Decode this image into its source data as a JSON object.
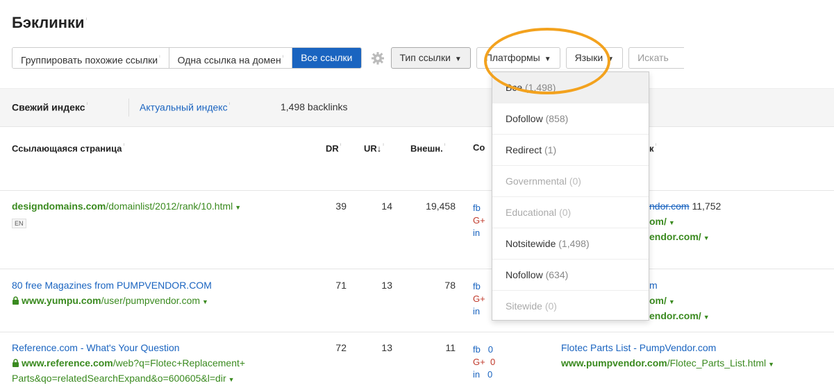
{
  "page": {
    "title": "Бэклинки"
  },
  "toolbar": {
    "group_similar": "Группировать похожие ссылки",
    "one_per_domain": "Одна ссылка на домен",
    "all_links": "Все ссылки",
    "link_type": "Тип ссылки",
    "platforms": "Платформы",
    "languages": "Языки",
    "search": "Искать"
  },
  "index": {
    "fresh": "Свежий индекс",
    "actual": "Актуальный индекс",
    "count": "1,498 backlinks"
  },
  "columns": {
    "referring_page": "Ссылающаяся страница",
    "dr": "DR",
    "ur": "UR↓",
    "external": "Внешн.",
    "social": "Со",
    "link": "к"
  },
  "rows": [
    {
      "title": "",
      "domain": "designdomains.com",
      "path": "/domainlist/2012/rank/10.html",
      "path2": "",
      "lang": "EN",
      "secure": false,
      "dr": "39",
      "ur": "14",
      "ext": "19,458",
      "fb": "fb",
      "fb_v": "",
      "gp": "G+",
      "gp_v": "",
      "in": "in",
      "in_v": "",
      "target_line1_strike": "ndor.com",
      "target_line1_num": "11,752",
      "target_line2": "om/",
      "target_line3": "endor.com/"
    },
    {
      "title": "80 free Magazines from PUMPVENDOR.COM",
      "domain": "www.yumpu.com",
      "path": "/user/pumpvendor.com",
      "path2": "",
      "lang": "",
      "secure": true,
      "dr": "71",
      "ur": "13",
      "ext": "78",
      "fb": "fb",
      "fb_v": "",
      "gp": "G+",
      "gp_v": "",
      "in": "in",
      "in_v": "",
      "target_line1_text": "m",
      "target_line2": "om/",
      "target_line3": "endor.com/"
    },
    {
      "title": "Reference.com - What's Your Question",
      "domain": "www.reference.com",
      "path": "/web?q=Flotec+Replacement+",
      "path2": "Parts&qo=relatedSearchExpand&o=600605&l=dir",
      "lang": "",
      "secure": true,
      "dr": "72",
      "ur": "13",
      "ext": "11",
      "fb": "fb",
      "fb_v": "0",
      "gp": "G+",
      "gp_v": "0",
      "in": "in",
      "in_v": "0",
      "target_title": "Flotec Parts List - PumpVendor.com",
      "target_domain": "www.pumpvendor.com",
      "target_path": "/Flotec_Parts_List.html"
    }
  ],
  "dropdown": {
    "items": [
      {
        "label": "Все",
        "count": "(1,498)",
        "state": "selected"
      },
      {
        "label": "Dofollow",
        "count": "(858)",
        "state": "normal"
      },
      {
        "label": "Redirect",
        "count": "(1)",
        "state": "normal"
      },
      {
        "label": "Governmental",
        "count": "(0)",
        "state": "disabled"
      },
      {
        "label": "Educational",
        "count": "(0)",
        "state": "disabled"
      },
      {
        "label": "Notsitewide",
        "count": "(1,498)",
        "state": "normal"
      },
      {
        "label": "Nofollow",
        "count": "(634)",
        "state": "normal"
      },
      {
        "label": "Sitewide",
        "count": "(0)",
        "state": "disabled"
      }
    ]
  },
  "colors": {
    "accent": "#1a64c0",
    "link_green": "#3a8a1f",
    "highlight": "#f3a21e"
  }
}
